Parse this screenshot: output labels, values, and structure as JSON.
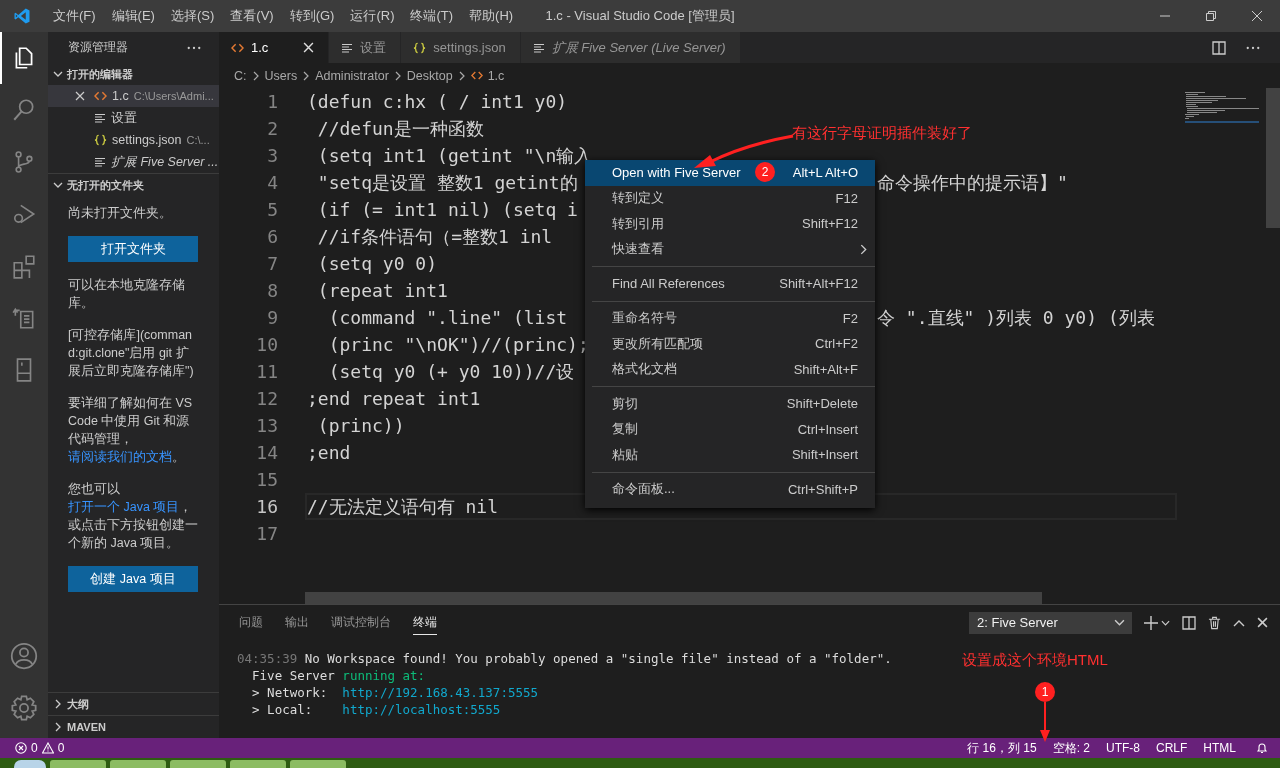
{
  "title_bar": {
    "menus": [
      "文件(F)",
      "编辑(E)",
      "选择(S)",
      "查看(V)",
      "转到(G)",
      "运行(R)",
      "终端(T)",
      "帮助(H)"
    ],
    "title": "1.c - Visual Studio Code [管理员]"
  },
  "activity_bar": {
    "items": [
      {
        "kind": "explorer",
        "selected": true
      },
      {
        "kind": "search",
        "selected": false
      },
      {
        "kind": "scm",
        "selected": false
      },
      {
        "kind": "debug",
        "selected": false
      },
      {
        "kind": "extensions",
        "selected": false
      },
      {
        "kind": "remote",
        "selected": false
      },
      {
        "kind": "book",
        "selected": false
      }
    ],
    "bottom": [
      {
        "kind": "account"
      },
      {
        "kind": "settings"
      }
    ]
  },
  "sidebar": {
    "title": "资源管理器",
    "open_editors": {
      "title": "打开的编辑器",
      "expanded": true,
      "items": [
        {
          "kind": "c",
          "name": "1.c",
          "path": "C:\\Users\\Admi...",
          "selected": true
        },
        {
          "kind": "settings",
          "name": "设置",
          "selected": false
        },
        {
          "kind": "json",
          "name": "settings.json",
          "path": "C:\\...",
          "selected": false
        },
        {
          "kind": "preview",
          "name": "扩展 Five Server ...",
          "selected": false
        }
      ]
    },
    "no_folder": {
      "title": "无打开的文件夹",
      "expanded": true,
      "blocks": [
        {
          "kind": "text",
          "parts": [
            {
              "text": "尚未打开文件夹。"
            }
          ]
        },
        {
          "kind": "button",
          "label": "打开文件夹"
        },
        {
          "kind": "text",
          "parts": [
            {
              "text": "可以在本地克隆存储库。"
            }
          ]
        },
        {
          "kind": "text",
          "parts": [
            {
              "text": "[可控存储库](command:git.clone\"启用 git 扩展后立即克隆存储库\")"
            }
          ]
        },
        {
          "kind": "text",
          "parts": [
            {
              "text": "要详细了解如何在 VS Code 中使用 Git 和源代码管理，"
            },
            {
              "text": "请阅读我们的文档",
              "link": true
            },
            {
              "text": "。"
            }
          ]
        },
        {
          "kind": "text",
          "parts": [
            {
              "text": "您也可以"
            },
            {
              "text": "打开一个 Java 项目",
              "link": true
            },
            {
              "text": "，或点击下方按钮创建一个新的 Java 项目。"
            }
          ]
        },
        {
          "kind": "button",
          "label": "创建 Java 项目"
        }
      ]
    },
    "collapsed": [
      {
        "title": "大纲",
        "expanded": false
      },
      {
        "title": "MAVEN",
        "expanded": false
      }
    ]
  },
  "tabs": [
    {
      "kind": "c",
      "label": "1.c",
      "selected": true
    },
    {
      "kind": "settings",
      "label": "设置",
      "selected": false
    },
    {
      "kind": "json",
      "label": "settings.json",
      "selected": false
    },
    {
      "kind": "preview",
      "label": "扩展 Five Server (Live Server)",
      "selected": false
    }
  ],
  "breadcrumb": [
    "C:",
    "Users",
    "Administrator",
    "Desktop",
    "1.c"
  ],
  "editor": {
    "lines": [
      {
        "n": "1",
        "text": "(defun c:hx ( / int1 y0)",
        "current": false
      },
      {
        "n": "2",
        "text": " //defun是一种函数",
        "current": false
      },
      {
        "n": "3",
        "text": " (setq int1 (getint \"\\n输入",
        "current": false
      },
      {
        "n": "4",
        "text": " \"setq是设置 整数1 getint的",
        "tail": "命令操作中的提示语】\"",
        "current": false
      },
      {
        "n": "5",
        "text": " (if (= int1 nil) (setq i",
        "current": false
      },
      {
        "n": "6",
        "text": " //if条件语句（=整数1 inl",
        "current": false
      },
      {
        "n": "7",
        "text": " (setq y0 0)",
        "current": false
      },
      {
        "n": "8",
        "text": " (repeat int1",
        "current": false
      },
      {
        "n": "9",
        "text": "  (command \".line\" (list",
        "tail": "令 \".直线\" )列表 0 y0) (列表",
        "current": false
      },
      {
        "n": "10",
        "text": "  (princ \"\\nOK\")//(princ);",
        "current": false
      },
      {
        "n": "11",
        "text": "  (setq y0 (+ y0 10))//设",
        "current": false
      },
      {
        "n": "12",
        "text": ";end repeat int1",
        "current": false
      },
      {
        "n": "13",
        "text": " (princ))",
        "current": false
      },
      {
        "n": "14",
        "text": ";end",
        "current": false
      },
      {
        "n": "15",
        "current": false
      },
      {
        "n": "16",
        "text": "//无法定义语句有 nil",
        "current": true
      },
      {
        "n": "17",
        "current": false
      }
    ]
  },
  "context_menu": {
    "groups": [
      [
        {
          "kind": "command",
          "label": "Open with Five Server",
          "shortcut": "Alt+L Alt+O",
          "selected": true
        },
        {
          "kind": "command",
          "label": "转到定义",
          "shortcut": "F12",
          "selected": false
        },
        {
          "kind": "command",
          "label": "转到引用",
          "shortcut": "Shift+F12",
          "selected": false
        },
        {
          "kind": "submenu",
          "label": "快速查看",
          "selected": false
        }
      ],
      [
        {
          "kind": "command",
          "label": "Find All References",
          "shortcut": "Shift+Alt+F12",
          "selected": false
        }
      ],
      [
        {
          "kind": "command",
          "label": "重命名符号",
          "shortcut": "F2",
          "selected": false
        },
        {
          "kind": "command",
          "label": "更改所有匹配项",
          "shortcut": "Ctrl+F2",
          "selected": false
        },
        {
          "kind": "command",
          "label": "格式化文档",
          "shortcut": "Shift+Alt+F",
          "selected": false
        }
      ],
      [
        {
          "kind": "command",
          "label": "剪切",
          "shortcut": "Shift+Delete",
          "selected": false
        },
        {
          "kind": "command",
          "label": "复制",
          "shortcut": "Ctrl+Insert",
          "selected": false
        },
        {
          "kind": "command",
          "label": "粘贴",
          "shortcut": "Shift+Insert",
          "selected": false
        }
      ],
      [
        {
          "kind": "command",
          "label": "命令面板...",
          "shortcut": "Ctrl+Shift+P",
          "selected": false
        }
      ]
    ]
  },
  "panel": {
    "tabs": [
      {
        "label": "问题",
        "selected": false
      },
      {
        "label": "输出",
        "selected": false
      },
      {
        "label": "调试控制台",
        "selected": false
      },
      {
        "label": "终端",
        "selected": true
      }
    ],
    "terminal_select": "2: Five Server",
    "terminal": [
      [
        {
          "kind": "timestamp",
          "text": "04:35:39"
        },
        {
          "kind": "plain",
          "text": " No Workspace found! You probably opened a \"single file\" instead of a \"folder\"."
        }
      ],
      [
        {
          "kind": "plain",
          "text": "  Five Server "
        },
        {
          "kind": "success",
          "text": "running at:"
        }
      ],
      [
        {
          "kind": "plain",
          "text": "  > Network:  "
        },
        {
          "kind": "url",
          "text": "http://192.168.43.137:5555"
        }
      ],
      [
        {
          "kind": "plain",
          "text": "  > Local:    "
        },
        {
          "kind": "url",
          "text": "http://localhost:5555"
        }
      ]
    ]
  },
  "status_bar": {
    "errors": "0",
    "warnings": "0",
    "items": [
      "行 16，列 15",
      "空格: 2",
      "UTF-8",
      "CRLF",
      "HTML"
    ]
  },
  "annotations": {
    "callouts": [
      "有这行字母证明插件装好了",
      "设置成这个环境HTML"
    ],
    "markers": [
      "1",
      "2"
    ]
  }
}
